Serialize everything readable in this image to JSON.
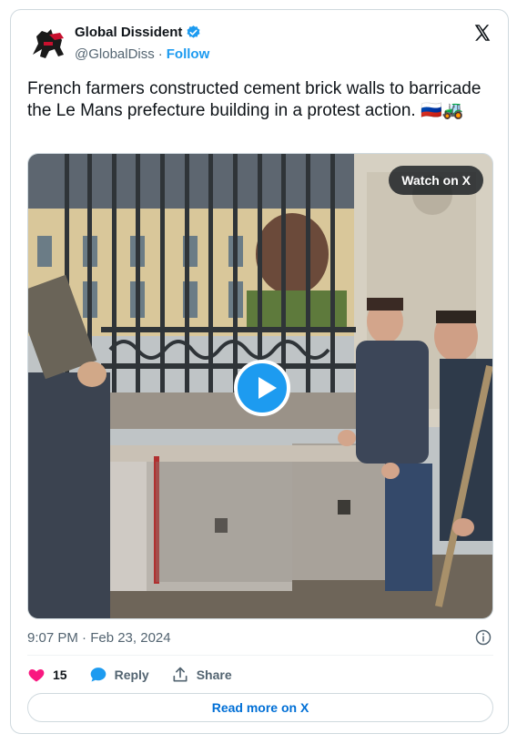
{
  "author": {
    "name": "Global Dissident",
    "handle": "@GlobalDiss",
    "separator": "·",
    "follow_label": "Follow"
  },
  "tweet": {
    "text": "French farmers constructed cement brick walls to barricade the Le Mans prefecture building in a protest action. 🇷🇺🚜"
  },
  "media": {
    "watch_label": "Watch on X"
  },
  "meta": {
    "timestamp": "9:07 PM · Feb 23, 2024"
  },
  "actions": {
    "likes_count": "15",
    "reply_label": "Reply",
    "share_label": "Share"
  },
  "read_more_label": "Read more on X",
  "colors": {
    "accent": "#1d9bf0",
    "like": "#f91880",
    "link": "#006fd6",
    "muted": "#536471",
    "border": "#cfd9de"
  }
}
